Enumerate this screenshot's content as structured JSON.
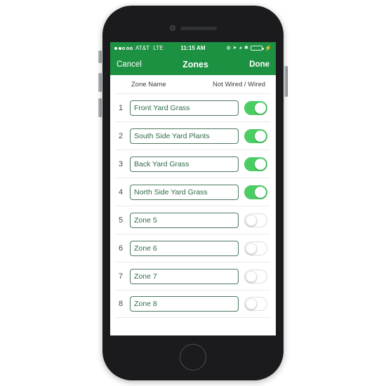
{
  "status_bar": {
    "signal_dots_filled": 2,
    "signal_dots_total": 5,
    "carrier": "AT&T",
    "network": "LTE",
    "time": "11:15 AM",
    "icons": [
      "do-not-disturb-icon",
      "location-arrow-icon",
      "alarm-clock-icon",
      "bluetooth-icon"
    ],
    "battery_percent": 82,
    "charging": true,
    "charging_glyph": "⚡"
  },
  "nav_bar": {
    "cancel_label": "Cancel",
    "title": "Zones",
    "done_label": "Done",
    "background_color": "#1d9142"
  },
  "table": {
    "header_zone_name": "Zone Name",
    "header_wired_state": "Not Wired / Wired",
    "rows": [
      {
        "number": "1",
        "name": "Front Yard Grass",
        "wired": true
      },
      {
        "number": "2",
        "name": "South Side Yard Plants",
        "wired": true
      },
      {
        "number": "3",
        "name": "Back Yard Grass",
        "wired": true
      },
      {
        "number": "4",
        "name": "North Side Yard Grass",
        "wired": true
      },
      {
        "number": "5",
        "name": "Zone 5",
        "wired": false
      },
      {
        "number": "6",
        "name": "Zone 6",
        "wired": false
      },
      {
        "number": "7",
        "name": "Zone 7",
        "wired": false
      },
      {
        "number": "8",
        "name": "Zone 8",
        "wired": false
      }
    ]
  },
  "colors": {
    "brand_green": "#1d9142",
    "toggle_on_green": "#4ccd63",
    "input_border": "#4e7a60",
    "input_text": "#2f6b49"
  }
}
